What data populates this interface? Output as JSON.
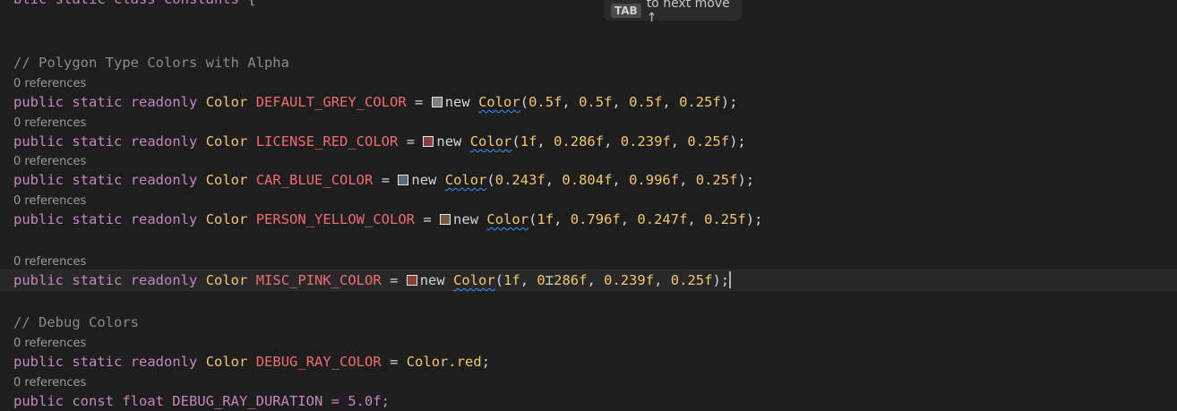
{
  "hint": {
    "key": "TAB",
    "text": "to next move ↑"
  },
  "lines": {
    "top": "blic static class Constants {",
    "comment_polygon": "// Polygon Type Colors with Alpha",
    "refs": "0 references",
    "kw_public": "public",
    "kw_static": "static",
    "kw_readonly": "readonly",
    "kw_new": "new",
    "type_color": "Color",
    "eq": "=",
    "c1_name": "DEFAULT_GREY_COLOR",
    "c1_args": [
      "0.5f",
      "0.5f",
      "0.5f",
      "0.25f"
    ],
    "c2_name": "LICENSE_RED_COLOR",
    "c2_args": [
      "1f",
      "0.286f",
      "0.239f",
      "0.25f"
    ],
    "c3_name": "CAR_BLUE_COLOR",
    "c3_args": [
      "0.243f",
      "0.804f",
      "0.996f",
      "0.25f"
    ],
    "c4_name": "PERSON_YELLOW_COLOR",
    "c4_args": [
      "1f",
      "0.796f",
      "0.247f",
      "0.25f"
    ],
    "c5_name": "MISC_PINK_COLOR",
    "c5_arg1": "1f",
    "c5_arg2a": "0",
    "c5_arg2b": "286f",
    "c5_arg3": "0.239f",
    "c5_arg4": "0.25f",
    "comment_debug": "// Debug Colors",
    "c6_name": "DEBUG_RAY_COLOR",
    "c6_value": "Color.red",
    "last": "public const float DEBUG_RAY_DURATION = 5.0f;"
  },
  "swatches": {
    "grey": "#7f7f7f",
    "red": "#8a3f3b",
    "blue": "#5a6a78",
    "yellow": "#7a5a3f",
    "pink": "#8a3f3b"
  },
  "colors": {
    "background": "#1e1e1e",
    "keyword": "#c586c0",
    "type": "#f2c66d",
    "constant": "#ef6b73",
    "comment": "#8a8a8a"
  }
}
